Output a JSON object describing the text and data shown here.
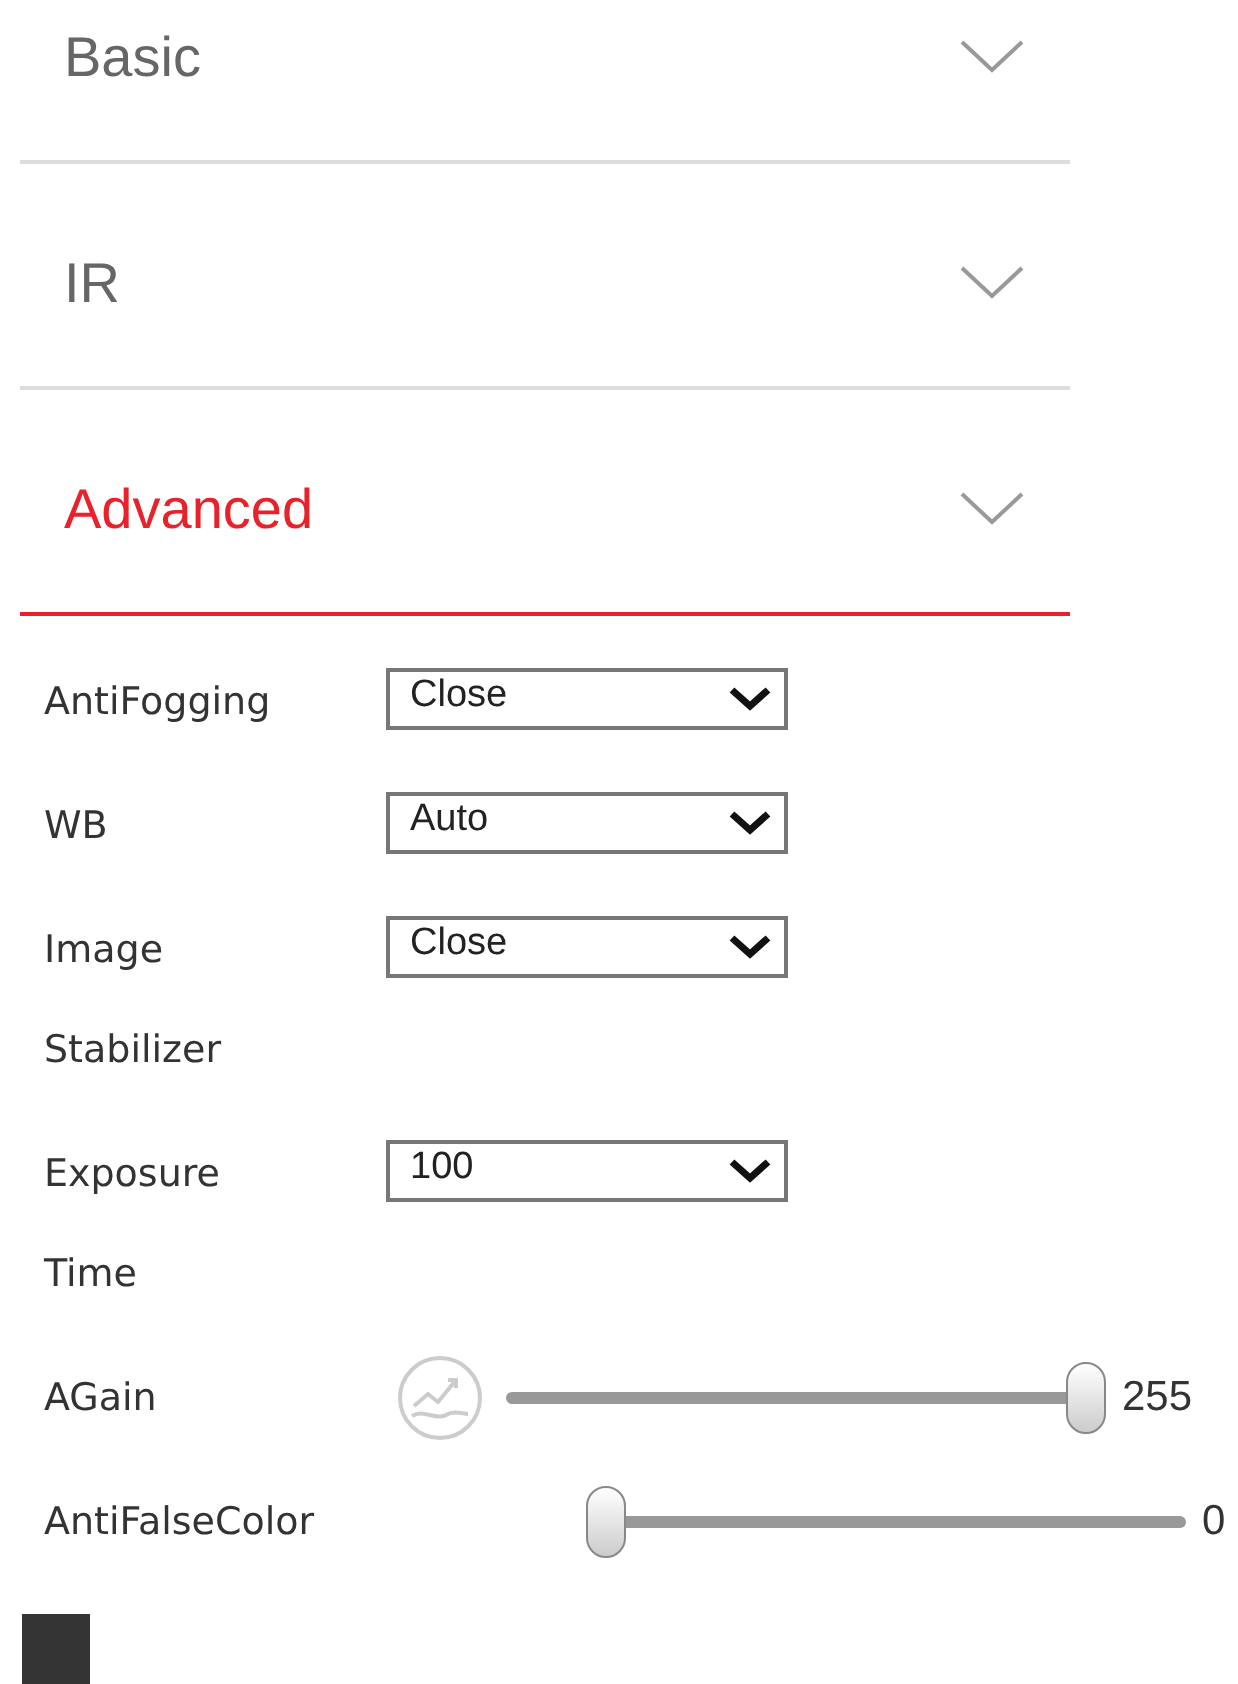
{
  "sections": [
    {
      "label": "Basic",
      "selected": false
    },
    {
      "label": "IR",
      "selected": false
    },
    {
      "label": "Advanced",
      "selected": true
    }
  ],
  "settings": [
    {
      "kind": "select",
      "label": "AntiFogging",
      "value": "Close"
    },
    {
      "kind": "select",
      "label": "WB",
      "value": "Auto"
    },
    {
      "kind": "select",
      "label": "Image Stabilizer",
      "value": "Close"
    },
    {
      "kind": "select",
      "label": "Exposure Time",
      "value": "100"
    },
    {
      "kind": "slider_with_icon",
      "label": "AGain",
      "level": 1,
      "reading": "255"
    },
    {
      "kind": "slider",
      "label": "AntiFalseColor",
      "level": 0,
      "reading": "0"
    }
  ]
}
